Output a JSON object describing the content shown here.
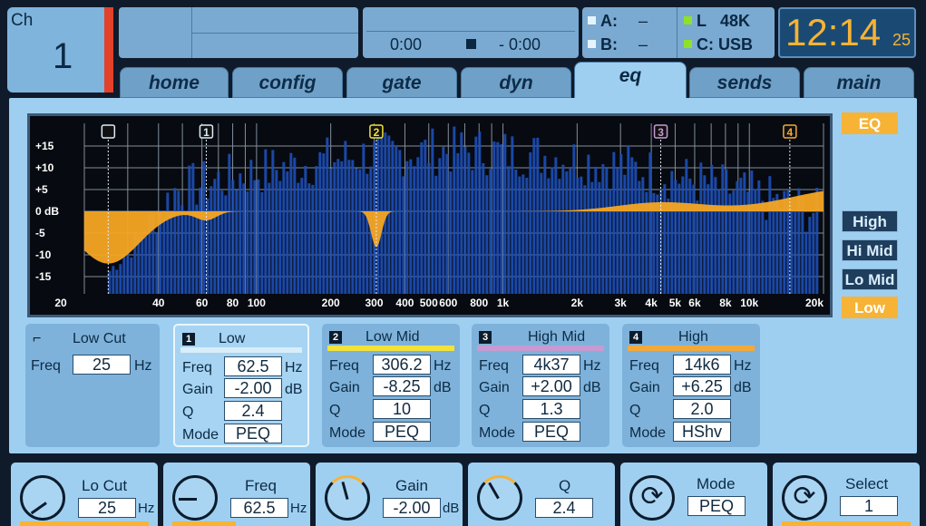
{
  "channel": {
    "label": "Ch",
    "number": "1"
  },
  "transport": {
    "position": "0:00",
    "remaining": "- 0:00"
  },
  "sources": {
    "a_label": "A:",
    "a_value": "–",
    "b_label": "B:",
    "b_value": "–",
    "l_label": "L",
    "l_value": "48K",
    "c_label": "C: USB"
  },
  "clock": {
    "time": "12:14",
    "seconds": "25"
  },
  "tabs": [
    "home",
    "config",
    "gate",
    "dyn",
    "eq",
    "sends",
    "main"
  ],
  "active_tab": "eq",
  "graph": {
    "y_labels": [
      "+15",
      "+10",
      "+5",
      "0 dB",
      "-5",
      "-10",
      "-15"
    ],
    "x_labels": [
      "20",
      "40",
      "60",
      "80",
      "100",
      "200",
      "300",
      "400",
      "500",
      "600",
      "800",
      "1k",
      "2k",
      "3k",
      "4k",
      "5k",
      "6k",
      "8k",
      "10k",
      "20k"
    ],
    "markers": [
      "1",
      "2",
      "3",
      "4"
    ]
  },
  "side_buttons": {
    "eq": "EQ",
    "high": "High",
    "himid": "Hi Mid",
    "lomid": "Lo Mid",
    "low": "Low"
  },
  "lowcut": {
    "title": "Low Cut",
    "freq_label": "Freq",
    "freq_value": "25",
    "freq_unit": "Hz"
  },
  "bands": [
    {
      "num": "1",
      "name": "Low",
      "freq": "62.5",
      "gain": "-2.00",
      "q": "2.4",
      "mode": "PEQ",
      "color": "#d9eef9"
    },
    {
      "num": "2",
      "name": "Low Mid",
      "freq": "306.2",
      "gain": "-8.25",
      "q": "10",
      "mode": "PEQ",
      "color": "#f2e23a"
    },
    {
      "num": "3",
      "name": "High Mid",
      "freq": "4k37",
      "gain": "+2.00",
      "q": "1.3",
      "mode": "PEQ",
      "color": "#c89ad2"
    },
    {
      "num": "4",
      "name": "High",
      "freq": "14k6",
      "gain": "+6.25",
      "q": "2.0",
      "mode": "HShv",
      "color": "#f3a93a"
    }
  ],
  "band_labels": {
    "freq": "Freq",
    "gain": "Gain",
    "q": "Q",
    "mode": "Mode",
    "hz": "Hz",
    "db": "dB"
  },
  "encoders": [
    {
      "title": "Lo Cut",
      "value": "25",
      "unit": "Hz"
    },
    {
      "title": "Freq",
      "value": "62.5",
      "unit": "Hz"
    },
    {
      "title": "Gain",
      "value": "-2.00",
      "unit": "dB"
    },
    {
      "title": "Q",
      "value": "2.4",
      "unit": ""
    },
    {
      "title": "Mode",
      "value": "PEQ",
      "unit": ""
    },
    {
      "title": "Select",
      "value": "1",
      "unit": ""
    }
  ],
  "colors": {
    "accent": "#f6b335",
    "panel": "#9fcff0",
    "red": "#e2412a"
  }
}
